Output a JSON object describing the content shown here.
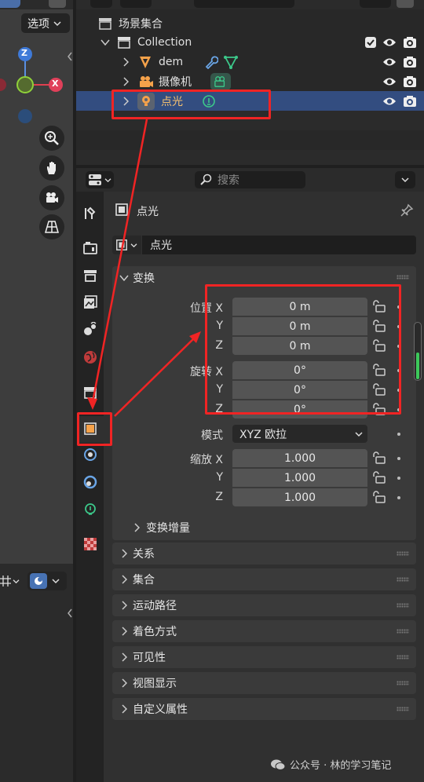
{
  "viewport": {
    "options_label": "选项",
    "nav_icons": [
      "zoom-icon",
      "hand-pan-icon",
      "camera-view-icon",
      "grid-perspective-icon"
    ],
    "gizmo": {
      "z": "Z",
      "x": "X"
    }
  },
  "outliner": {
    "search_placeholder": "搜索",
    "scene_collection": "场景集合",
    "collection": "Collection",
    "items": [
      {
        "name": "dem",
        "icon": "mesh-icon"
      },
      {
        "name": "摄像机",
        "icon": "camera-icon"
      },
      {
        "name": "点光",
        "icon": "light-icon",
        "selected": true
      }
    ]
  },
  "properties": {
    "search_placeholder": "搜索",
    "object_title": "点光",
    "object_name": "点光",
    "transform": {
      "title": "变换",
      "location_label": "位置",
      "rotation_label": "旋转",
      "scale_label": "缩放",
      "axes": [
        "X",
        "Y",
        "Z"
      ],
      "location": [
        "0 m",
        "0 m",
        "0 m"
      ],
      "rotation": [
        "0°",
        "0°",
        "0°"
      ],
      "mode_label": "模式",
      "mode_value": "XYZ 欧拉",
      "scale": [
        "1.000",
        "1.000",
        "1.000"
      ],
      "delta_label": "变换增量"
    },
    "panels": [
      "关系",
      "集合",
      "运动路径",
      "着色方式",
      "可见性",
      "视图显示",
      "自定义属性"
    ]
  },
  "watermark": "公众号 · 林的学习笔记",
  "colors": {
    "accent_red": "#f02424",
    "selected_row": "#334d80",
    "active_tab": "#f5a24a"
  }
}
